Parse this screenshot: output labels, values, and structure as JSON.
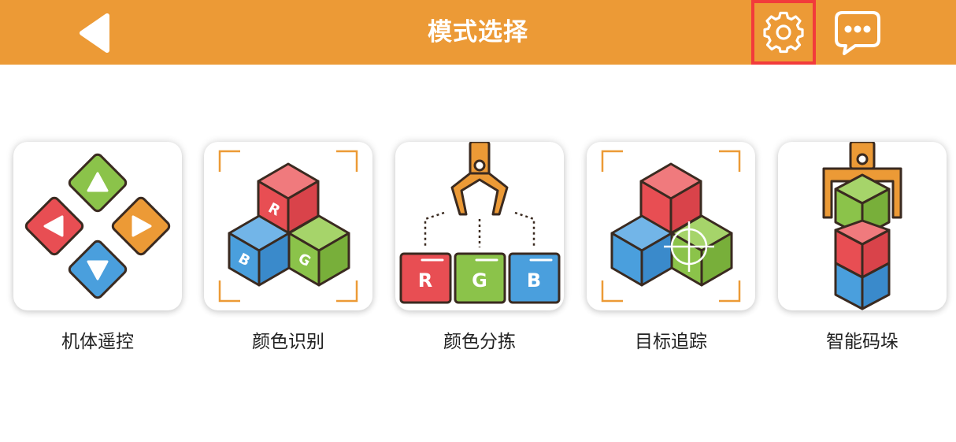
{
  "header": {
    "title": "模式选择",
    "background": "#EC9A36",
    "back_icon": "chevron-left-icon",
    "settings_icon": "gear-icon",
    "chat_icon": "chat-bubble-icon",
    "settings_highlight_color": "#F23B3B"
  },
  "modes": [
    {
      "label": "机体遥控",
      "icon": "dpad-remote-control-icon"
    },
    {
      "label": "颜色识别",
      "icon": "rgb-cubes-icon",
      "cube_letters": [
        "R",
        "B",
        "G"
      ]
    },
    {
      "label": "颜色分拣",
      "icon": "claw-sorting-icon",
      "box_letters": [
        "R",
        "G",
        "B"
      ]
    },
    {
      "label": "目标追踪",
      "icon": "target-tracking-cubes-icon"
    },
    {
      "label": "智能码垛",
      "icon": "claw-stacking-cubes-icon"
    }
  ],
  "colors": {
    "red": "#E84E53",
    "green": "#8BC34A",
    "blue": "#4A9FDD",
    "orange": "#EC9A36",
    "outline": "#3A2A20"
  }
}
